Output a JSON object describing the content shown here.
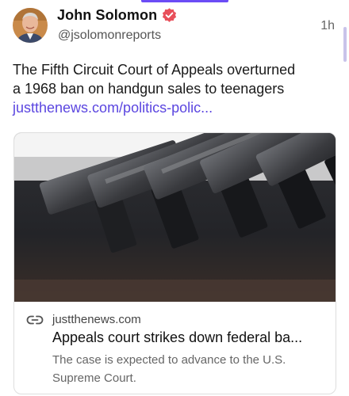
{
  "post": {
    "author_name": "John Solomon",
    "author_handle": "@jsolomonreports",
    "time": "1h",
    "text_lines": [
      "The Fifth Circuit Court of Appeals overturned",
      "a 1968 ban on handgun sales to teenagers"
    ],
    "link_text": "justthenews.com/politics-polic..."
  },
  "link_card": {
    "domain": "justthenews.com",
    "title": "Appeals court strikes down federal ba...",
    "description": "The case is expected to advance to the U.S. Supreme Court."
  },
  "icons": {
    "verified": "verified-badge-icon",
    "link": "link-icon"
  },
  "colors": {
    "accent": "#6b4cf6",
    "link": "#5b46e0",
    "verified": "#e8505b",
    "text": "#1a1a1a",
    "secondary_text": "#666666",
    "card_border": "#dedede"
  }
}
